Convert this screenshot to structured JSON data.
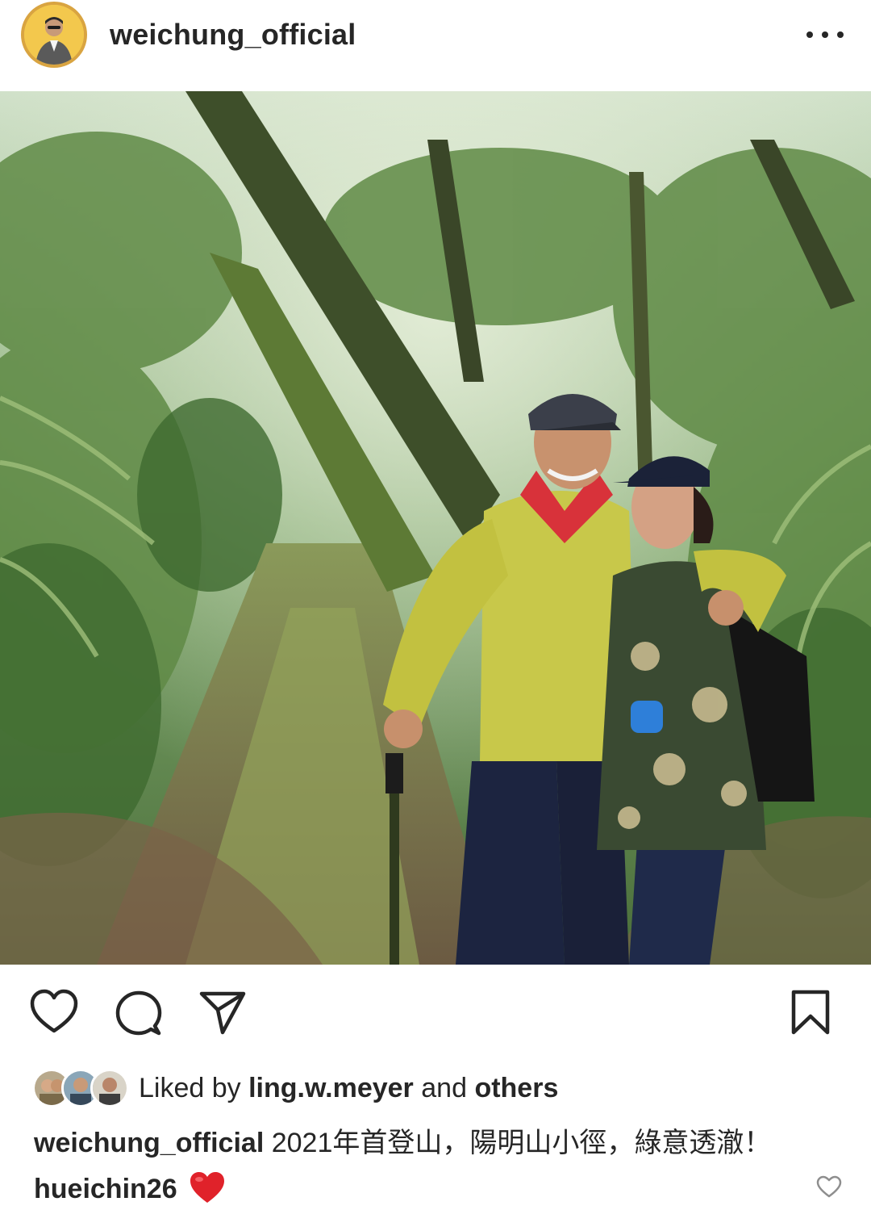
{
  "post": {
    "author": "weichung_official",
    "more_menu": "more-options"
  },
  "actions": {
    "like": "heart-icon",
    "comment": "comment-icon",
    "share": "send-icon",
    "save": "bookmark-icon"
  },
  "likes": {
    "prefix": "Liked by",
    "user": "ling.w.meyer",
    "connector": "and",
    "others": "others"
  },
  "caption": {
    "user": "weichung_official",
    "text": "2021年首登山，陽明山小徑，綠意透澈！"
  },
  "comments": [
    {
      "user": "hueichin26",
      "emoji": "❤️"
    }
  ],
  "colors": {
    "text": "#262626",
    "heart_red": "#e0222a",
    "avatar_ring": "#d9a441"
  }
}
